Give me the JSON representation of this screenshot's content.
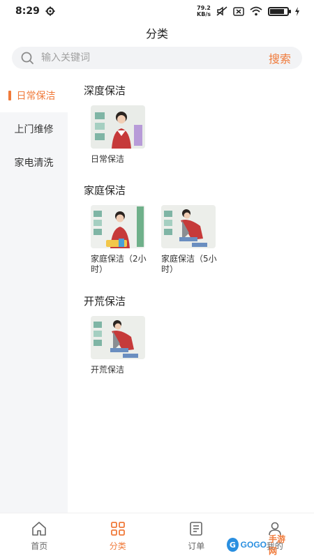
{
  "status_bar": {
    "time": "8:29",
    "net_speed_value": "79.2",
    "net_speed_unit": "KB/s",
    "battery_level": 0.85
  },
  "header": {
    "title": "分类"
  },
  "search": {
    "placeholder": "输入关键词",
    "button_label": "搜索"
  },
  "sidebar": {
    "items": [
      {
        "label": "日常保洁",
        "active": true
      },
      {
        "label": "上门维修",
        "active": false
      },
      {
        "label": "家电清洗",
        "active": false
      }
    ]
  },
  "sections": [
    {
      "title": "深度保洁",
      "cards": [
        {
          "label": "日常保洁"
        }
      ]
    },
    {
      "title": "家庭保洁",
      "cards": [
        {
          "label": "家庭保洁（2小时）"
        },
        {
          "label": "家庭保洁（5小时）"
        }
      ]
    },
    {
      "title": "开荒保洁",
      "cards": [
        {
          "label": "开荒保洁"
        }
      ]
    }
  ],
  "tab_bar": {
    "tabs": [
      {
        "label": "首页",
        "icon": "home-icon",
        "active": false
      },
      {
        "label": "分类",
        "icon": "category-icon",
        "active": true
      },
      {
        "label": "订单",
        "icon": "order-icon",
        "active": false
      },
      {
        "label": "我的",
        "icon": "profile-icon",
        "active": false
      }
    ]
  },
  "watermark": {
    "part1": "GOGO",
    "part2": "手游网"
  },
  "colors": {
    "accent": "#f07a3a",
    "sidebar_bg": "#f5f6f8",
    "search_bg": "#f2f3f5"
  }
}
